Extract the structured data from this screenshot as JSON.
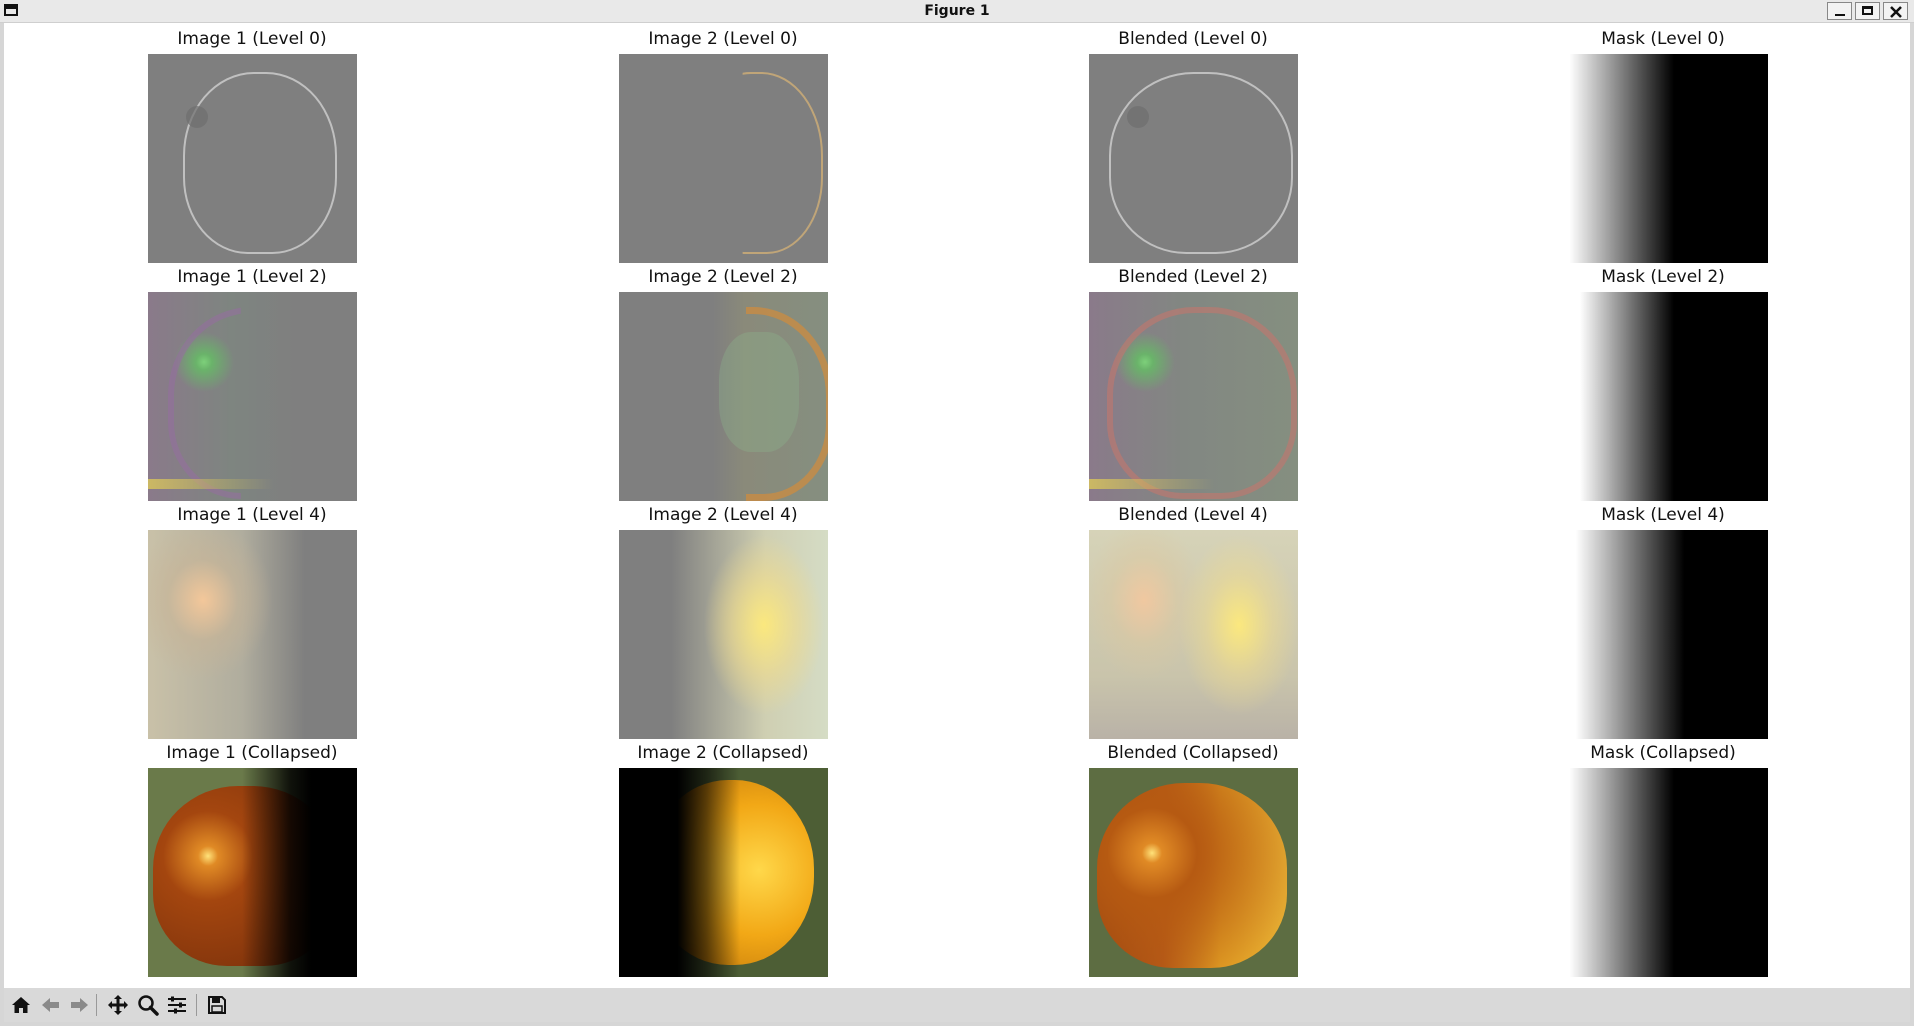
{
  "window": {
    "title": "Figure 1"
  },
  "rows": [
    {
      "titles": [
        "Image 1 (Level 0)",
        "Image 2 (Level 0)",
        "Blended (Level 0)",
        "Mask (Level 0)"
      ]
    },
    {
      "titles": [
        "Image 1 (Level 2)",
        "Image 2 (Level 2)",
        "Blended (Level 2)",
        "Mask (Level 2)"
      ]
    },
    {
      "titles": [
        "Image 1 (Level 4)",
        "Image 2 (Level 4)",
        "Blended (Level 4)",
        "Mask (Level 4)"
      ]
    },
    {
      "titles": [
        "Image 1 (Collapsed)",
        "Image 2 (Collapsed)",
        "Blended (Collapsed)",
        "Mask (Collapsed)"
      ]
    }
  ],
  "toolbar": {
    "icons": [
      "home-icon",
      "back-arrow-icon",
      "forward-arrow-icon",
      "pan-icon",
      "zoom-icon",
      "configure-subplots-icon",
      "save-icon"
    ]
  }
}
